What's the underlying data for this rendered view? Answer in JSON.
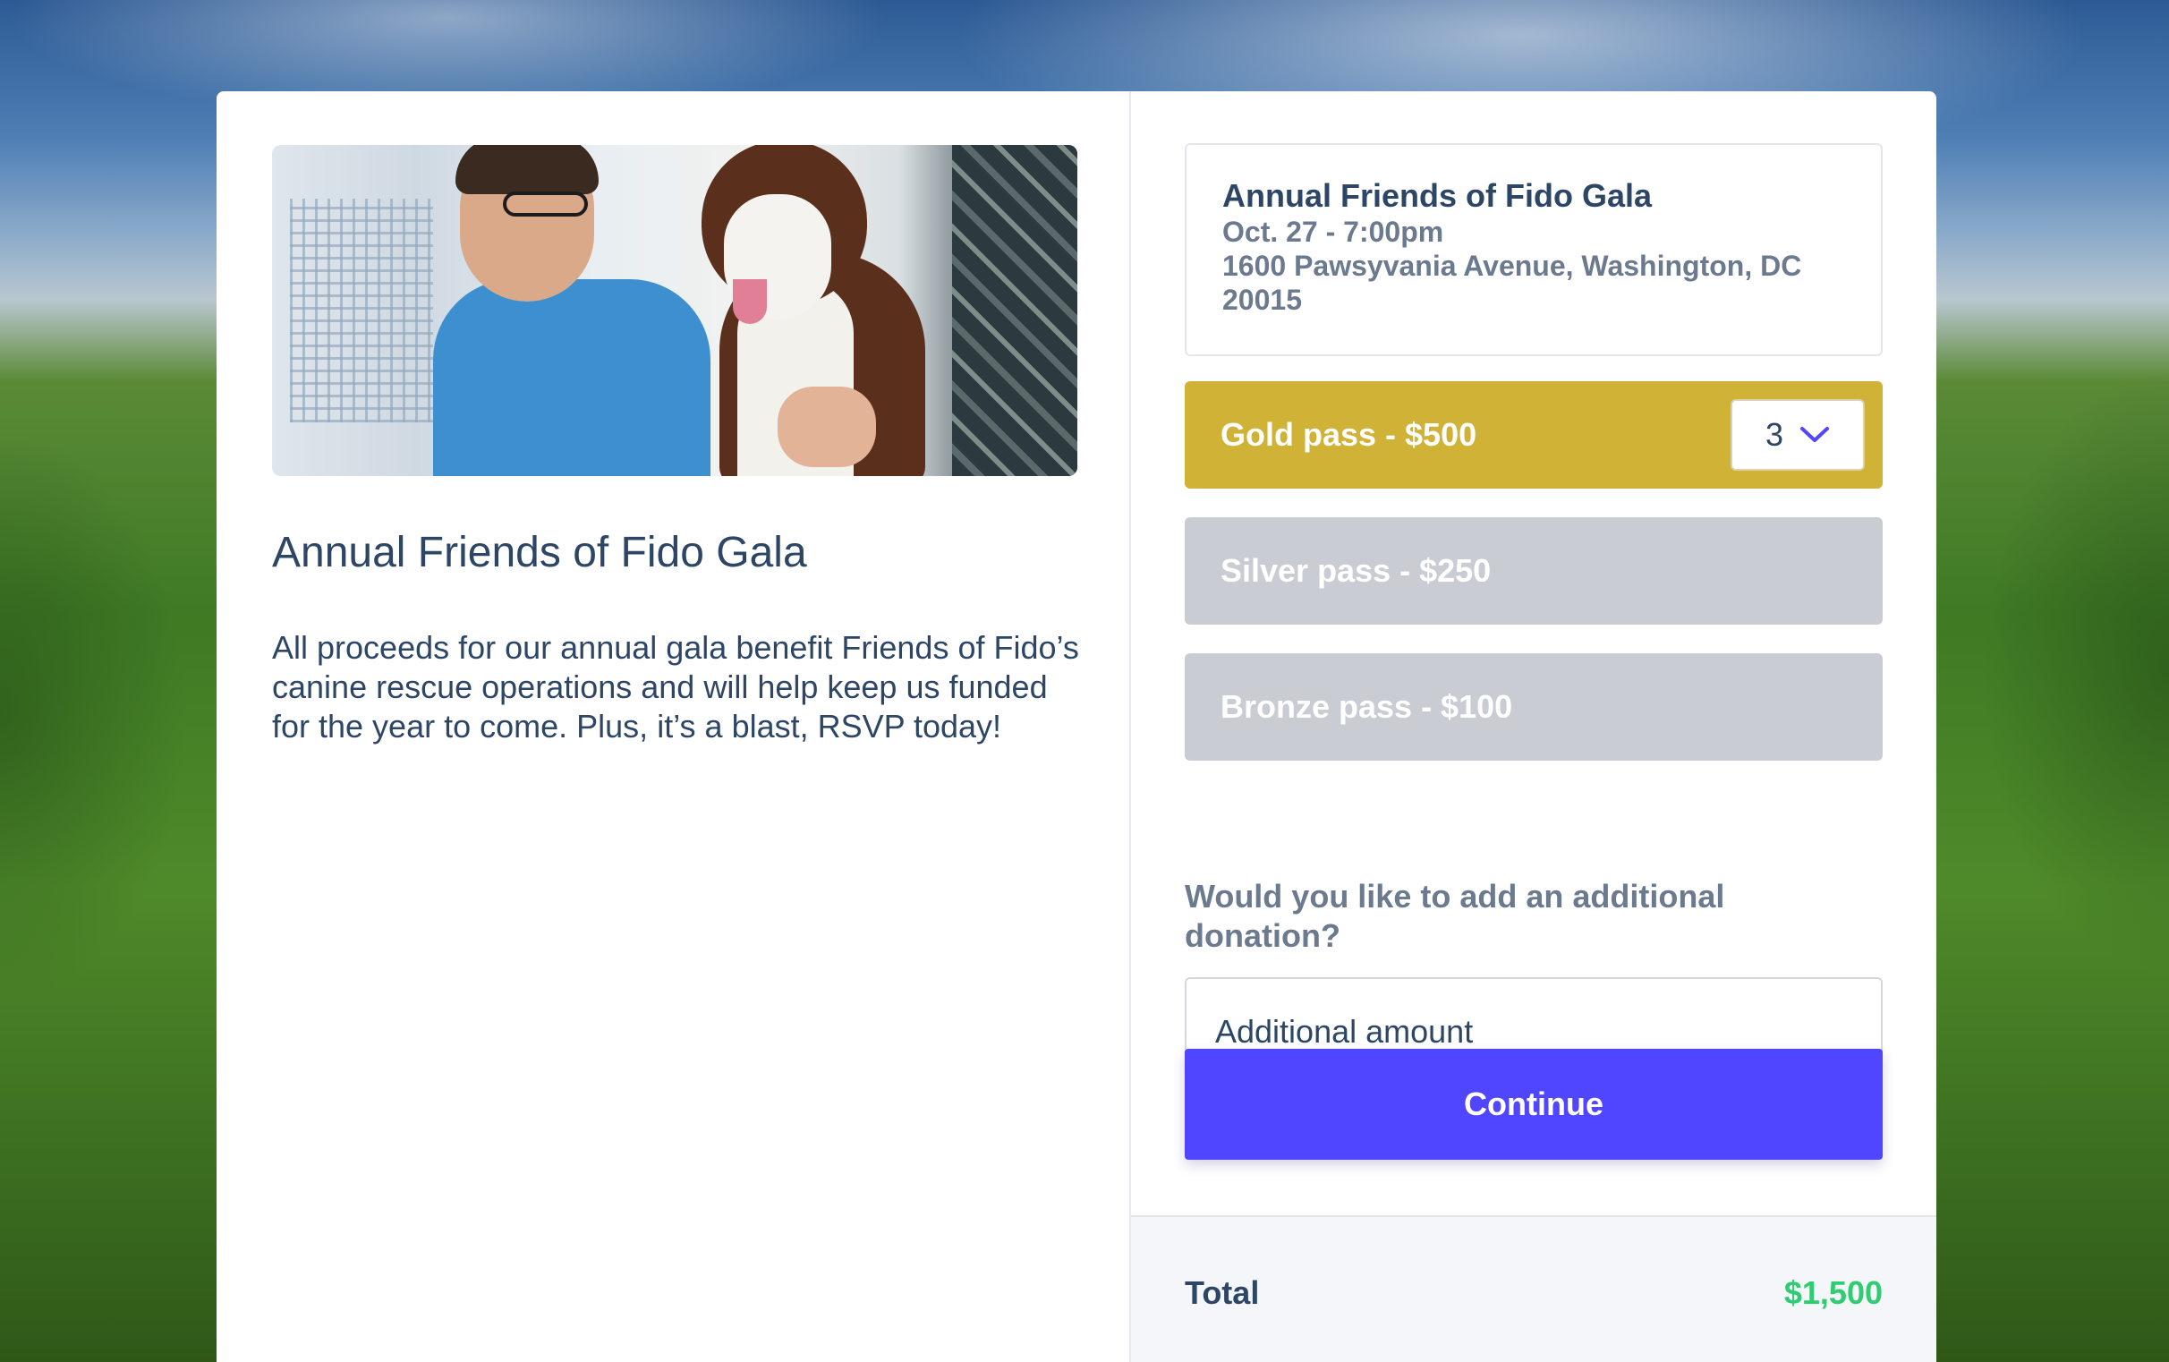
{
  "event": {
    "title": "Annual Friends of Fido Gala",
    "description": "All proceeds for our annual gala benefit Friends of Fido’s canine rescue operations and will help keep us funded for the year to come. Plus, it’s a blast, RSVP today!"
  },
  "info": {
    "name": "Annual Friends of Fido Gala",
    "when": "Oct. 27 - 7:00pm",
    "where": "1600 Pawsyvania Avenue, Washington, DC 20015"
  },
  "passes": [
    {
      "label": "Gold pass - $500",
      "quantity": "3",
      "selected": true,
      "color": "#cfb236"
    },
    {
      "label": "Silver pass - $250",
      "selected": false,
      "color": "#c9cdd3"
    },
    {
      "label": "Bronze pass - $100",
      "selected": false,
      "color": "#c9cdd3"
    }
  ],
  "donation": {
    "question": "Would you like to add an additional donation?",
    "placeholder": "Additional amount",
    "value": ""
  },
  "actions": {
    "continue_label": "Continue"
  },
  "total": {
    "label": "Total",
    "amount": "$1,500"
  },
  "colors": {
    "accent": "#5046ff",
    "gold": "#cfb236",
    "total": "#2fcc71",
    "text": "#2e4666"
  },
  "icons": {
    "quantity_dropdown": "chevron-down-icon"
  }
}
